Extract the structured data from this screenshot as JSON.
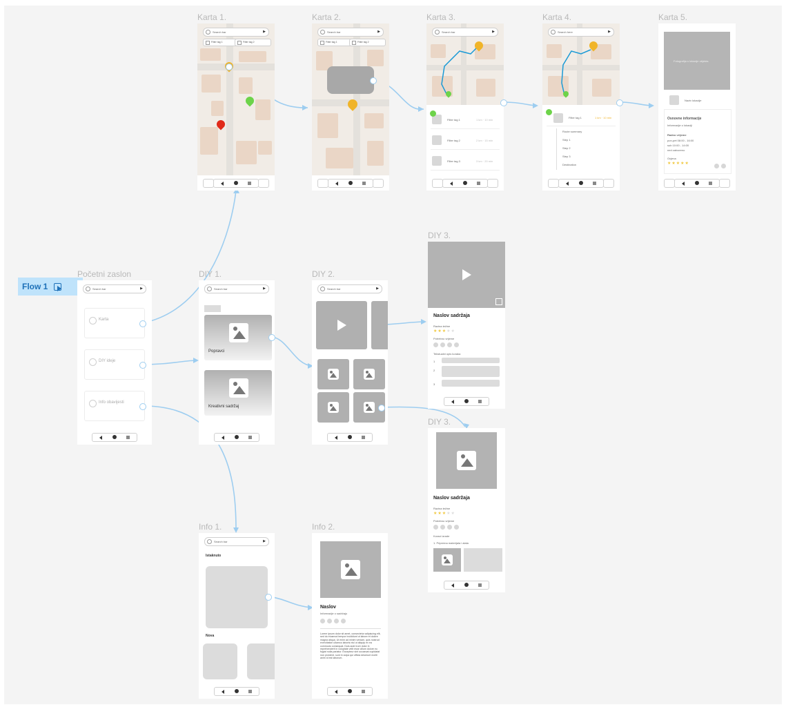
{
  "flow": {
    "label": "Flow 1",
    "icon": "flow-play-icon"
  },
  "frames": {
    "karta1": {
      "title": "Karta 1.",
      "search_text": "Search bar",
      "chip1": "Filter tag 1",
      "chip2": "Filter tag 2"
    },
    "karta2": {
      "title": "Karta 2.",
      "search_text": "Search bar",
      "chip1": "Filter tag 1",
      "chip2": "Filter tag 2"
    },
    "karta3": {
      "title": "Karta 3.",
      "search_text": "Search bar",
      "rows": [
        {
          "name": "Filter tag 1",
          "meta": "1 km · 10 min"
        },
        {
          "name": "Filter tag 2",
          "meta": "2 km · 15 min"
        },
        {
          "name": "Filter tag 3",
          "meta": "3 km · 20 min"
        }
      ]
    },
    "karta4": {
      "title": "Karta 4.",
      "search_text": "Search here",
      "row": {
        "name": "Filter tag 1",
        "meta": "1 km · 10 min"
      },
      "steps": [
        "Route summary",
        "Step 1",
        "Step 2",
        "Step 3",
        "Destination"
      ]
    },
    "karta5": {
      "title": "Karta 5.",
      "image_caption": "Fotografija s lokacije objekta",
      "place_name": "Naziv lokacije",
      "info_title": "Osnovne informacije",
      "info_sub": "Informacije o lokaciji",
      "hours_title": "Radno vrijeme",
      "hours": [
        "pon-pet 08:00 - 16:00",
        "sub 10:00 - 14:00",
        "ned zatvoreno"
      ],
      "rating_label": "Ocjena"
    },
    "home": {
      "title": "Početni zaslon",
      "search_text": "Search bar",
      "cards": [
        "Karta",
        "DIY ideje",
        "Info obavijesti"
      ]
    },
    "diy1": {
      "title": "DIY 1.",
      "search_text": "Search bar",
      "card1": "Popravci",
      "card2": "Kreativni sadržaj"
    },
    "diy2": {
      "title": "DIY 2.",
      "search_text": "Search bar"
    },
    "diy3a": {
      "title": "DIY 3.",
      "content_title": "Naslov sadržaja",
      "difficulty_label": "Razina težine",
      "time_label": "Potrebno vrijeme",
      "steps_label": "Tekstualni opis koraka"
    },
    "diy3b": {
      "title": "DIY 3.",
      "content_title": "Naslov sadržaja",
      "difficulty_label": "Razina težine",
      "time_label": "Potrebno vrijeme",
      "steps_label": "Koraci izrade",
      "step1": "1. Priprema materijala i alata"
    },
    "info1": {
      "title": "Info 1.",
      "search_text": "Search bar",
      "section1": "Istaknuto",
      "section2": "Nova"
    },
    "info2": {
      "title": "Info 2.",
      "heading": "Naslov",
      "subheading": "Informacije o sadržaju",
      "body": "Lorem ipsum dolor sit amet, consectetur adipiscing elit, sed do eiusmod tempor incididunt ut labore et dolore magna aliqua. Ut enim ad minim veniam, quis nostrud exercitation ullamco laboris nisi ut aliquip ex ea commodo consequat. Duis aute irure dolor in reprehenderit in voluptate velit esse cillum dolore eu fugiat nulla pariatur. Excepteur sint occaecat cupidatat non proident, sunt in culpa qui officia deserunt mollit anim id est laborum."
    }
  },
  "colors": {
    "connector": "#9dcdf0",
    "pin_orange": "#f0b429",
    "pin_green": "#6dd34a",
    "pin_red": "#e02a1a",
    "route": "#1a9ad6",
    "placeholder": "#b3b3b3"
  }
}
